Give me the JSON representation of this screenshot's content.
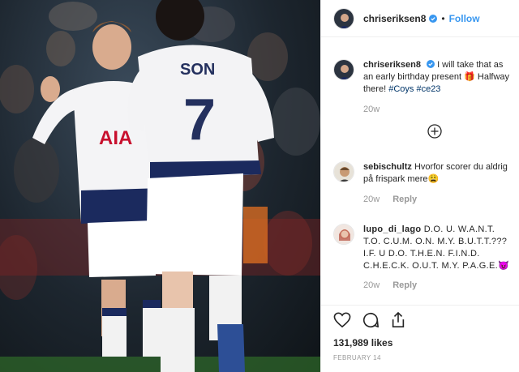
{
  "header": {
    "username": "chriseriksen8",
    "separator": "•",
    "follow_label": "Follow"
  },
  "caption": {
    "username": "chriseriksen8",
    "text": "I will take that as an early birthday present 🎁 Halfway there!",
    "hashtag1": "#Coys",
    "hashtag2": "#ce23",
    "time": "20w"
  },
  "comments": [
    {
      "username": "sebischultz",
      "text": "Hvorfor scorer du aldrig på frispark mere😩",
      "time": "20w",
      "reply_label": "Reply"
    },
    {
      "username": "lupo_di_lago",
      "text": "D.O. U. W.A.N.T. T.O. C.U.M. O.N. M.Y. B.U.T.T.??? I.F. U D.O. T.H.E.N. F.I.N.D. C.H.E.C.K. O.U.T. M.Y. P.A.G.E.😈",
      "time": "20w",
      "reply_label": "Reply"
    }
  ],
  "likes": "131,989 likes",
  "date": "FEBRUARY 14",
  "photo": {
    "player_left_shirt_text": "AIA",
    "player_right_name": "SON",
    "player_right_number": "7"
  },
  "icons": {
    "verified": "verified-badge-icon",
    "load_more": "plus-circle-icon",
    "like": "heart-icon",
    "comment": "comment-bubble-icon",
    "share": "share-icon"
  },
  "colors": {
    "link_blue": "#3897f0",
    "hashtag_navy": "#003569",
    "meta_grey": "#999999",
    "text": "#262626",
    "spurs_navy": "#132257"
  }
}
